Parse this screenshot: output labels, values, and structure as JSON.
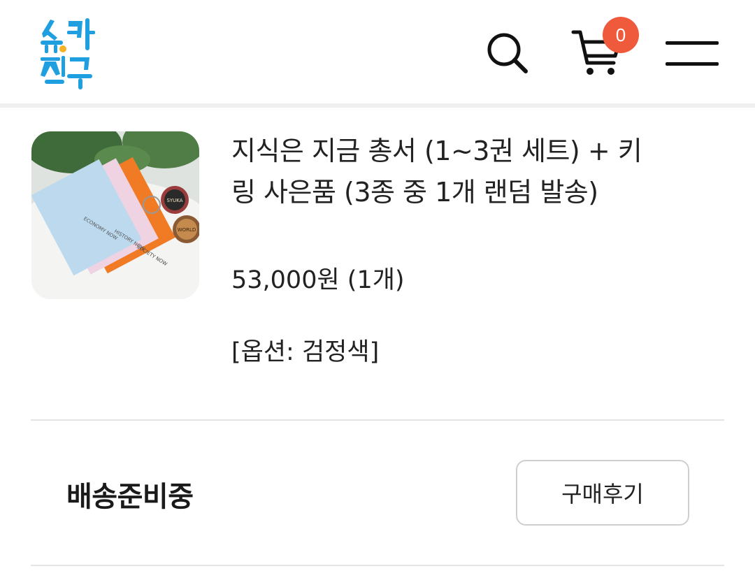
{
  "header": {
    "logo_text": "슈카친구",
    "cart_count": "0",
    "icons": {
      "search": "search-icon",
      "cart": "cart-icon",
      "menu": "hamburger-menu-icon"
    },
    "colors": {
      "logo": "#1f9ee0",
      "badge": "#ef5a3c"
    }
  },
  "order_item": {
    "title": "지식은 지금 총서 (1~3권 세트) + 키링 사은품 (3종 중 1개 랜덤 발송)",
    "price": "53,000원 (1개)",
    "option": "[옵션: 검정색]",
    "thumbnail": {
      "book_labels": [
        "ECONOMY NOW",
        "HISTORY NOW",
        "SOCIETY NOW"
      ],
      "keyring_labels": [
        "SYUKA",
        "WORLD"
      ]
    }
  },
  "order_status": {
    "label": "배송준비중",
    "review_button": "구매후기"
  }
}
